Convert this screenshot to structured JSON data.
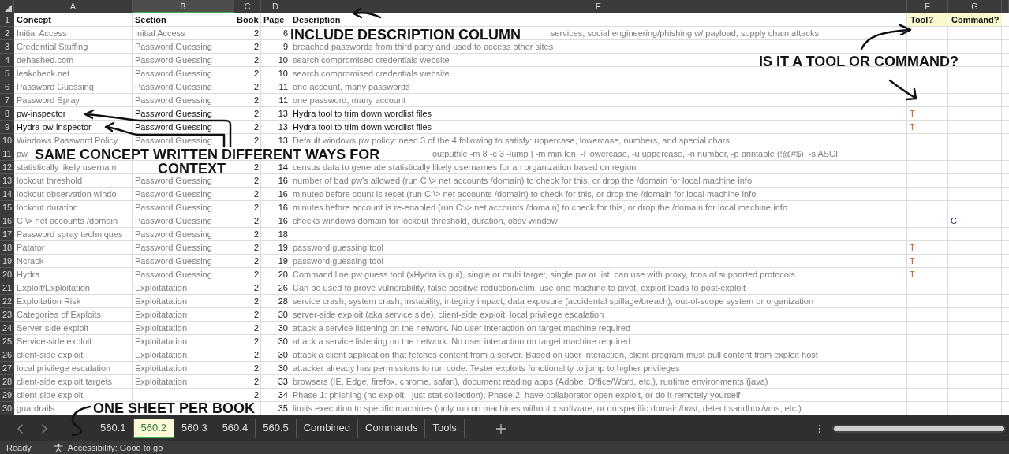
{
  "column_headers": [
    {
      "label": "A",
      "selected": false
    },
    {
      "label": "B",
      "selected": true
    },
    {
      "label": "C",
      "selected": false
    },
    {
      "label": "D",
      "selected": false
    },
    {
      "label": "E",
      "selected": false
    },
    {
      "label": "F",
      "selected": false
    },
    {
      "label": "G",
      "selected": false
    }
  ],
  "header_row": {
    "number": "1",
    "cells": [
      "Concept",
      "Section",
      "Book",
      "Page",
      "Description",
      "Tool?",
      "Command?"
    ]
  },
  "rows": [
    {
      "number": "2",
      "blurred": true,
      "concept": "Initial Access",
      "section": "Initial Access",
      "book": "2",
      "page": "6",
      "description": "services, social engineering/phishing w/ payload, supply chain attacks"
    },
    {
      "number": "3",
      "blurred": true,
      "concept": "Credential Stuffing",
      "section": "Password Guessing",
      "book": "2",
      "page": "9",
      "description": "breached passwords from third party and used to access other sites"
    },
    {
      "number": "4",
      "blurred": true,
      "concept": "dehashed.com",
      "section": "Password Guessing",
      "book": "2",
      "page": "10",
      "description": "search compromised credentials website"
    },
    {
      "number": "5",
      "blurred": true,
      "concept": "leakcheck.net",
      "section": "Password Guessing",
      "book": "2",
      "page": "10",
      "description": "search compromised credentials website"
    },
    {
      "number": "6",
      "blurred": true,
      "concept": "Password Guessing",
      "section": "Password Guessing",
      "book": "2",
      "page": "11",
      "description": "one account, many passwords"
    },
    {
      "number": "7",
      "blurred": true,
      "concept": "Password Spray",
      "section": "Password Guessing",
      "book": "2",
      "page": "11",
      "description": "one password, many account"
    },
    {
      "number": "8",
      "blurred": false,
      "concept": "pw-inspector",
      "section": "Password Guessing",
      "book": "2",
      "page": "13",
      "description": "Hydra tool to trim down wordlist files",
      "tool": "T"
    },
    {
      "number": "9",
      "blurred": false,
      "concept": "Hydra pw-inspector",
      "section": "Password Guessing",
      "book": "2",
      "page": "13",
      "description": "Hydra tool to trim down wordlist files",
      "tool": "T"
    },
    {
      "number": "10",
      "blurred": true,
      "concept": "Windows Password Policy",
      "section": "Password Guessing",
      "book": "2",
      "page": "13",
      "description": "Default windows pw policy: need 3 of the 4 following to satisfy: uppercase, lowercase, numbers, and special chars"
    },
    {
      "number": "11",
      "blurred": true,
      "concept": "pw",
      "description": "outputfile -m 8 -c 3 -lump  |  -m min len, -l lowercase, -u uppercase, -n number, -p printable (!@#$), -s ASCII"
    },
    {
      "number": "12",
      "blurred": true,
      "concept": "statistically likely usernam",
      "book": "2",
      "page": "14",
      "description": "census data to generate statistically likely usernames for an organization based on region"
    },
    {
      "number": "13",
      "blurred": true,
      "concept": "lockout threshold",
      "section": "Password Guessing",
      "book": "2",
      "page": "16",
      "description": "number of bad pw's allowed   (run C:\\> net accounts /domain) to check for this, or drop the /domain for local machine info"
    },
    {
      "number": "14",
      "blurred": true,
      "concept": "lockout observation windo",
      "section": "Password Guessing",
      "book": "2",
      "page": "16",
      "description": "minutes before count is reset (run C:\\> net accounts /domain) to check for this, or drop the /domain for local machine info"
    },
    {
      "number": "15",
      "blurred": true,
      "concept": "lockout duration",
      "section": "Password Guessing",
      "book": "2",
      "page": "16",
      "description": "minutes before account is re-enabled (run C:\\> net accounts /domain) to check for this, or drop the /domain for local machine info"
    },
    {
      "number": "16",
      "blurred": true,
      "concept": "C:\\> net accounts /domain",
      "section": "Password Guessing",
      "book": "2",
      "page": "16",
      "description": "checks windows domain for lockout threshold, duration, obsv window",
      "command": "C"
    },
    {
      "number": "17",
      "blurred": true,
      "concept": "Password spray techniques",
      "section": "Password Guessing",
      "book": "2",
      "page": "18"
    },
    {
      "number": "18",
      "blurred": true,
      "concept": "Patator",
      "section": "Password Guessing",
      "book": "2",
      "page": "19",
      "description": "password guessing tool",
      "tool": "T"
    },
    {
      "number": "19",
      "blurred": true,
      "concept": "Ncrack",
      "section": "Password Guessing",
      "book": "2",
      "page": "19",
      "description": "password guessing tool",
      "tool": "T"
    },
    {
      "number": "20",
      "blurred": true,
      "concept": "Hydra",
      "section": "Password Guessing",
      "book": "2",
      "page": "20",
      "description": "Command line pw guess tool (xHydra is gui), single or multi target, single pw or list, can use with proxy, tons of supported protocols",
      "tool": "T"
    },
    {
      "number": "21",
      "blurred": true,
      "concept": "Exploit/Exploitation",
      "section": "Exploitatation",
      "book": "2",
      "page": "26",
      "description": "Can be used to prove vulnerability, false positive reduction/elim, use one machine to pivot, exploit leads to post-exploit"
    },
    {
      "number": "22",
      "blurred": true,
      "concept": "Exploitation Risk",
      "section": "Exploitatation",
      "book": "2",
      "page": "28",
      "description": "service crash, system crash, instability, integrity impact, data exposure (accidental spillage/breach), out-of-scope system or organization"
    },
    {
      "number": "23",
      "blurred": true,
      "concept": "Categories of Exploits",
      "section": "Exploitatation",
      "book": "2",
      "page": "30",
      "description": "server-side exploit (aka service side), client-side exploit, local privilege escalation"
    },
    {
      "number": "24",
      "blurred": true,
      "concept": "Server-side exploit",
      "section": "Exploitatation",
      "book": "2",
      "page": "30",
      "description": "attack a service listening on the network. No user interaction on target machine required"
    },
    {
      "number": "25",
      "blurred": true,
      "concept": "Service-side exploit",
      "section": "Exploitatation",
      "book": "2",
      "page": "30",
      "description": "attack a service listening on the network. No user interaction on target machine required"
    },
    {
      "number": "26",
      "blurred": true,
      "concept": "client-side exploit",
      "section": "Exploitatation",
      "book": "2",
      "page": "30",
      "description": "attack a client application that fetches content from a server. Based on user interaction, client program must pull content from exploit host"
    },
    {
      "number": "27",
      "blurred": true,
      "concept": "local privilege escalation",
      "section": "Exploitatation",
      "book": "2",
      "page": "30",
      "description": "attacker already has permissions to run code. Tester exploits functionality to jump to higher privileges"
    },
    {
      "number": "28",
      "blurred": true,
      "concept": "client-side exploit targets",
      "section": "Exploitatation",
      "book": "2",
      "page": "33",
      "description": "browsers (IE, Edge, firefox, chrome, safari), document reading apps (Adobe, Office/Word, etc.), runtime environments (java)"
    },
    {
      "number": "29",
      "blurred": true,
      "concept": "client-side exploit",
      "book": "2",
      "page": "34",
      "description": "Phase 1: phishing (no exploit - just stat collection), Phase 2: have collaborator open exploit, or do it remotely yourself"
    },
    {
      "number": "30",
      "blurred": true,
      "concept": "guardrails",
      "page": "35",
      "description": "limits execution to specific machines (only run on machines without x software, or on specific domain/host, detect sandbox/vms, etc.)"
    }
  ],
  "annotations": [
    {
      "text": "INCLUDE DESCRIPTION COLUMN"
    },
    {
      "text": "IS IT A TOOL OR COMMAND?"
    },
    {
      "text": "SAME CONCEPT WRITTEN DIFFERENT WAYS FOR"
    },
    {
      "text": "CONTEXT"
    },
    {
      "text": "ONE SHEET PER BOOK"
    }
  ],
  "sheet_tabs": [
    {
      "label": "560.1",
      "selected": false
    },
    {
      "label": "560.2",
      "selected": true
    },
    {
      "label": "560.3",
      "selected": false
    },
    {
      "label": "560.4",
      "selected": false
    },
    {
      "label": "560.5",
      "selected": false
    },
    {
      "label": "Combined",
      "selected": false
    },
    {
      "label": "Commands",
      "selected": false
    },
    {
      "label": "Tools",
      "selected": false
    }
  ],
  "status_bar": {
    "mode": "Ready",
    "accessibility": "Accessibility: Good to go"
  }
}
